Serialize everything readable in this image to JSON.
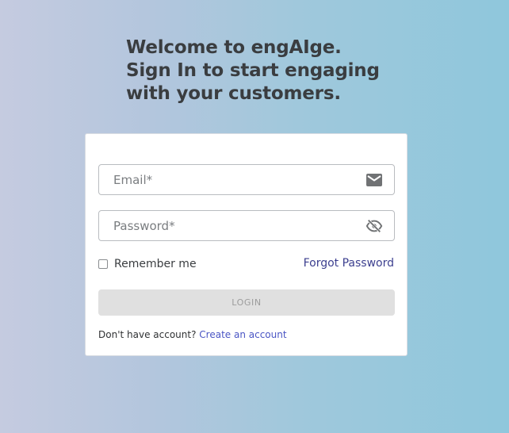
{
  "headline": {
    "line1": "Welcome to engAIge.",
    "line2": "Sign In to start engaging",
    "line3": "with your customers."
  },
  "form": {
    "email": {
      "placeholder": "Email*",
      "value": "",
      "icon": "mail-icon"
    },
    "password": {
      "placeholder": "Password*",
      "value": "",
      "icon": "eye-off-icon"
    },
    "remember_label": "Remember me",
    "remember_checked": false,
    "forgot_label": "Forgot Password",
    "login_label": "LOGIN",
    "signup_prompt": "Don't have account?",
    "signup_link": "Create an account"
  },
  "colors": {
    "link": "#3c3f8f",
    "create_link": "#4a55c4",
    "heading": "#3a3d40",
    "button_disabled": "#e0e0e0"
  }
}
